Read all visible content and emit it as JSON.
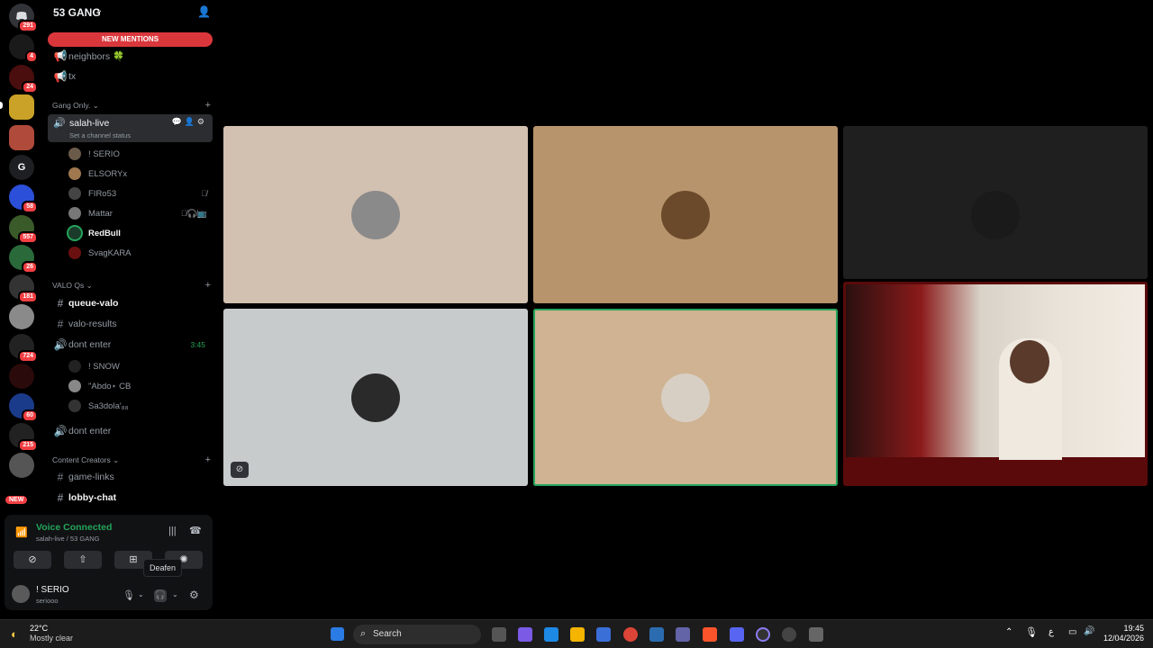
{
  "server": {
    "name": "53 GANG",
    "new_mentions": "NEW MENTIONS"
  },
  "rail_badges": [
    "291",
    "4",
    "24",
    "58",
    "557",
    "26",
    "181",
    "724",
    "60",
    "215"
  ],
  "rail_letter": "G",
  "rail_new": "NEW",
  "channels": {
    "top": [
      {
        "name": "neighbors 🍀"
      },
      {
        "name": "tx"
      }
    ],
    "gang_category": "Gang Only.",
    "active": {
      "name": "salah-live",
      "status": "Set a channel status"
    },
    "active_users": [
      "! SERIO",
      "ELSORYx",
      "FIRo53",
      "Mattar",
      "RedBull",
      "SvagKARA"
    ],
    "valo_category": "VALO Qs",
    "valo": [
      {
        "name": "queue-valo"
      },
      {
        "name": "valo-results"
      },
      {
        "name": "dont enter",
        "timer": "3:45"
      }
    ],
    "dont_enter_users": [
      "! SNOW",
      "\"Abdo⋆ CB",
      "Sa3dola'₈₈"
    ],
    "dont_enter_2": "dont enter",
    "cc_category": "Content Creators",
    "cc": [
      {
        "name": "game-links"
      },
      {
        "name": "lobby-chat"
      }
    ]
  },
  "voice": {
    "status": "Voice Connected",
    "location": "salah-live / 53 GANG"
  },
  "tooltip": "Deafen",
  "me": {
    "name": "! SERIO",
    "handle": "seriooo"
  },
  "weather": {
    "temp": "22°C",
    "desc": "Mostly clear"
  },
  "taskbar": {
    "search": "Search"
  },
  "clock": {
    "time": "19:45",
    "date": "12/04/2026"
  },
  "colors": {
    "accent": "#23a55a",
    "danger": "#da373c",
    "blurple": "#5865f2"
  }
}
